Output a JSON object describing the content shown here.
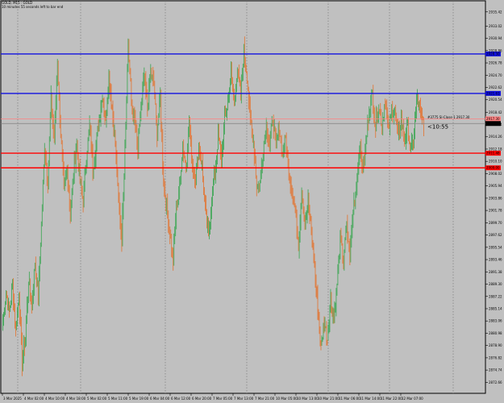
{
  "header": {
    "symbol_line": "GOLD, M15 : GOLD",
    "timer_line": "10 minutes 55 seconds left to bar end"
  },
  "countdown": "<10:55",
  "order_tag": "#3775 Sl-Close 1 2917.30",
  "colors": {
    "background": "#c0c0c0",
    "bull": "#44a85a",
    "bear": "#e07a3c",
    "blue_line": "#1010e0",
    "red_line": "#ff0000",
    "pink_line": "#ff8080",
    "bid_line": "#808080",
    "grid": "#6e6e6e"
  },
  "chart_data": {
    "type": "candlestick",
    "timeframe": "M15",
    "symbol": "GOLD",
    "ylim": [
      2870.8,
      2937.3
    ],
    "price_ticks": [
      "2935.42",
      "2933.02",
      "2930.94",
      "2928.86",
      "2926.78",
      "2924.70",
      "2922.62",
      "2920.54",
      "2918.42",
      "2916.34",
      "2914.26",
      "2912.18",
      "2910.10",
      "2908.02",
      "2905.94",
      "2903.86",
      "2901.78",
      "2899.70",
      "2897.62",
      "2895.54",
      "2893.46",
      "2891.38",
      "2889.30",
      "2887.22",
      "2885.14",
      "2883.06",
      "2880.98",
      "2878.90",
      "2876.82",
      "2874.74",
      "2872.66"
    ],
    "time_labels": [
      "3 Mar 2025",
      "4 Mar 02:00",
      "4 Mar 10:00",
      "4 Mar 18:00",
      "5 Mar 02:00",
      "5 Mar 11:00",
      "5 Mar 19:00",
      "6 Mar 04:00",
      "6 Mar 12:00",
      "6 Mar 20:00",
      "7 Mar 05:00",
      "7 Mar 13:00",
      "7 Mar 21:00",
      "10 Mar 05:00",
      "10 Mar 13:00",
      "10 Mar 21:00",
      "11 Mar 06:00",
      "11 Mar 14:00",
      "11 Mar 22:00",
      "12 Mar 07:00"
    ],
    "day_separators": [
      "4 Mar",
      "5 Mar",
      "6 Mar",
      "7 Mar",
      "10 Mar",
      "11 Mar",
      "12 Mar"
    ],
    "horizontal_lines": [
      {
        "price": 2928.3,
        "label": "2928.30",
        "color": "blue"
      },
      {
        "price": 2921.61,
        "label": "2921.61",
        "color": "blue"
      },
      {
        "price": 2917.3,
        "label": "2917.30",
        "color": "pink"
      },
      {
        "price": 2916.51,
        "label": "2916.51",
        "color": "bid"
      },
      {
        "price": 2911.48,
        "label": "2911.48",
        "color": "red"
      },
      {
        "price": 2909.0,
        "label": "2909.00",
        "color": "red"
      }
    ],
    "current_price": 2916.51,
    "anchors": [
      [
        0,
        2883.0
      ],
      [
        4,
        2888.0
      ],
      [
        8,
        2884.5
      ],
      [
        12,
        2889.0
      ],
      [
        16,
        2881.5
      ],
      [
        20,
        2887.5
      ],
      [
        24,
        2876.0
      ],
      [
        28,
        2880.5
      ],
      [
        32,
        2890.0
      ],
      [
        36,
        2885.5
      ],
      [
        40,
        2893.0
      ],
      [
        44,
        2887.0
      ],
      [
        48,
        2899.5
      ],
      [
        52,
        2912.5
      ],
      [
        56,
        2907.0
      ],
      [
        60,
        2920.5
      ],
      [
        64,
        2913.5
      ],
      [
        68,
        2926.5
      ],
      [
        72,
        2915.0
      ],
      [
        76,
        2905.5
      ],
      [
        80,
        2909.0
      ],
      [
        84,
        2901.5
      ],
      [
        88,
        2908.0
      ],
      [
        92,
        2913.5
      ],
      [
        96,
        2906.5
      ],
      [
        100,
        2903.5
      ],
      [
        104,
        2911.0
      ],
      [
        108,
        2916.0
      ],
      [
        112,
        2909.0
      ],
      [
        116,
        2912.5
      ],
      [
        120,
        2917.5
      ],
      [
        124,
        2921.5
      ],
      [
        128,
        2916.5
      ],
      [
        132,
        2925.0
      ],
      [
        136,
        2919.0
      ],
      [
        140,
        2913.0
      ],
      [
        144,
        2903.0
      ],
      [
        148,
        2897.0
      ],
      [
        152,
        2913.0
      ],
      [
        156,
        2929.5
      ],
      [
        160,
        2920.5
      ],
      [
        164,
        2917.0
      ],
      [
        168,
        2912.0
      ],
      [
        172,
        2919.0
      ],
      [
        176,
        2924.5
      ],
      [
        180,
        2919.0
      ],
      [
        184,
        2925.5
      ],
      [
        188,
        2923.0
      ],
      [
        192,
        2915.0
      ],
      [
        196,
        2921.0
      ],
      [
        200,
        2906.5
      ],
      [
        204,
        2902.5
      ],
      [
        208,
        2898.0
      ],
      [
        212,
        2893.5
      ],
      [
        216,
        2902.5
      ],
      [
        220,
        2905.5
      ],
      [
        224,
        2913.0
      ],
      [
        228,
        2909.0
      ],
      [
        232,
        2916.5
      ],
      [
        236,
        2910.0
      ],
      [
        240,
        2907.0
      ],
      [
        244,
        2913.0
      ],
      [
        248,
        2909.5
      ],
      [
        252,
        2902.0
      ],
      [
        256,
        2897.5
      ],
      [
        260,
        2904.0
      ],
      [
        264,
        2908.0
      ],
      [
        268,
        2914.5
      ],
      [
        272,
        2910.5
      ],
      [
        276,
        2917.0
      ],
      [
        280,
        2920.0
      ],
      [
        284,
        2925.0
      ],
      [
        288,
        2919.5
      ],
      [
        292,
        2926.0
      ],
      [
        296,
        2921.0
      ],
      [
        300,
        2929.0
      ],
      [
        304,
        2924.5
      ],
      [
        308,
        2917.0
      ],
      [
        312,
        2913.5
      ],
      [
        316,
        2906.0
      ],
      [
        320,
        2906.5
      ],
      [
        324,
        2912.0
      ],
      [
        328,
        2916.5
      ],
      [
        332,
        2912.5
      ],
      [
        336,
        2917.5
      ],
      [
        340,
        2913.0
      ],
      [
        344,
        2916.0
      ],
      [
        348,
        2911.0
      ],
      [
        352,
        2914.0
      ],
      [
        356,
        2908.5
      ],
      [
        360,
        2905.0
      ],
      [
        364,
        2901.5
      ],
      [
        368,
        2896.0
      ],
      [
        372,
        2905.5
      ],
      [
        376,
        2899.5
      ],
      [
        380,
        2903.0
      ],
      [
        384,
        2898.5
      ],
      [
        388,
        2892.0
      ],
      [
        392,
        2885.5
      ],
      [
        396,
        2878.5
      ],
      [
        400,
        2883.0
      ],
      [
        404,
        2880.0
      ],
      [
        408,
        2886.5
      ],
      [
        412,
        2883.5
      ],
      [
        416,
        2889.5
      ],
      [
        420,
        2897.0
      ],
      [
        424,
        2893.5
      ],
      [
        428,
        2899.0
      ],
      [
        432,
        2894.5
      ],
      [
        436,
        2902.0
      ],
      [
        440,
        2906.0
      ],
      [
        444,
        2912.5
      ],
      [
        448,
        2909.0
      ],
      [
        452,
        2913.0
      ],
      [
        456,
        2919.0
      ],
      [
        460,
        2921.5
      ],
      [
        464,
        2916.0
      ],
      [
        468,
        2919.5
      ],
      [
        472,
        2916.5
      ],
      [
        476,
        2920.5
      ],
      [
        480,
        2915.5
      ],
      [
        484,
        2918.5
      ],
      [
        488,
        2919.0
      ],
      [
        492,
        2914.0
      ],
      [
        496,
        2917.0
      ],
      [
        500,
        2913.5
      ],
      [
        504,
        2916.0
      ],
      [
        508,
        2911.5
      ],
      [
        512,
        2915.0
      ],
      [
        516,
        2921.0
      ],
      [
        520,
        2918.0
      ],
      [
        524,
        2916.5
      ]
    ]
  }
}
